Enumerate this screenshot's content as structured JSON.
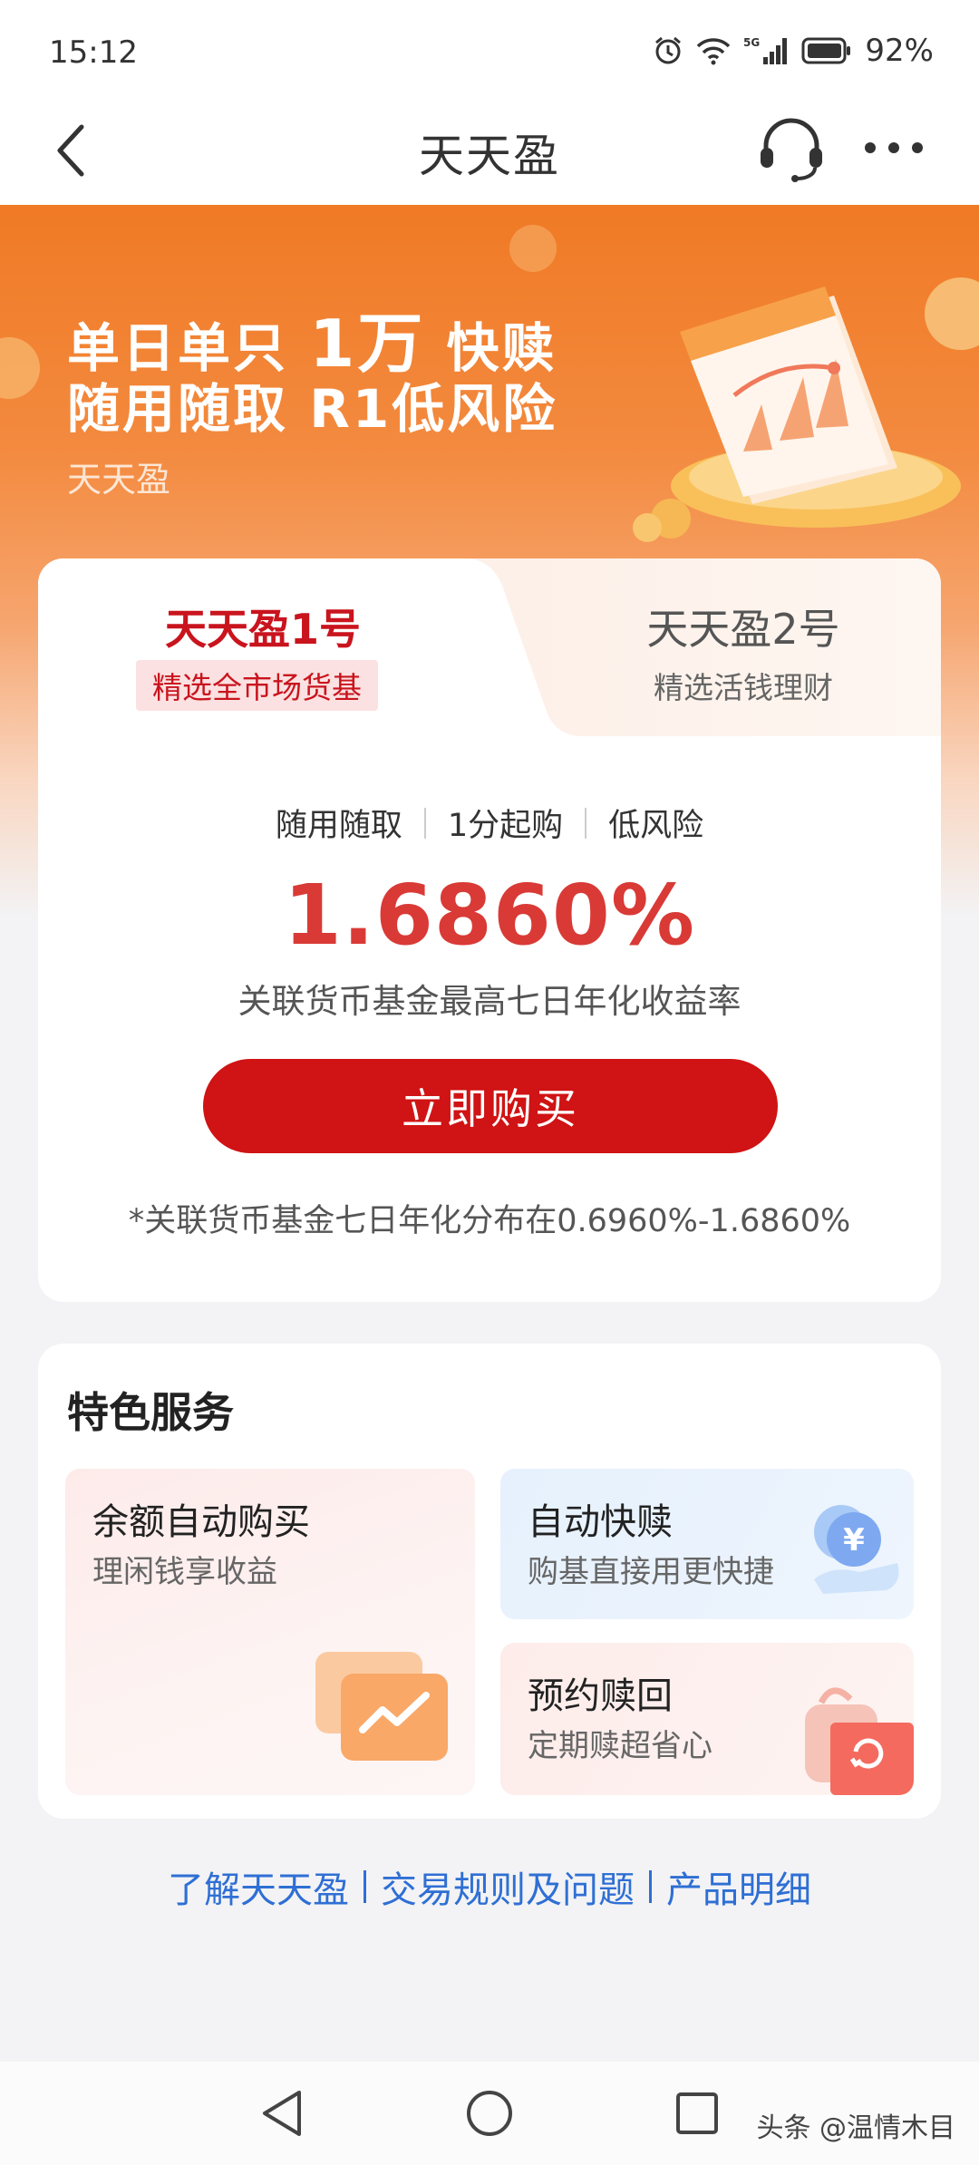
{
  "status_bar": {
    "time": "15:12",
    "battery": "92%",
    "network": "5G"
  },
  "nav": {
    "title": "天天盈",
    "back_icon": "chevron-left-icon",
    "service_icon": "headset-icon",
    "more_icon": "more-dots-icon"
  },
  "hero": {
    "line1_a": "单日单只",
    "line1_b": "1万",
    "line1_c": "快赎",
    "line2": "随用随取 R1低风险",
    "brand": "天天盈"
  },
  "product": {
    "tabs": [
      {
        "name": "天天盈1号",
        "subtitle": "精选全市场货基",
        "active": true
      },
      {
        "name": "天天盈2号",
        "subtitle": "精选活钱理财",
        "active": false
      }
    ],
    "features": [
      "随用随取",
      "1分起购",
      "低风险"
    ],
    "rate": "1.6860%",
    "rate_label": "关联货币基金最高七日年化收益率",
    "buy_label": "立即购买",
    "footnote": "*关联货币基金七日年化分布在0.6960%-1.6860%"
  },
  "services": {
    "title": "特色服务",
    "items": [
      {
        "title": "余额自动购买",
        "subtitle": "理闲钱享收益",
        "icon": "chart-screen-icon"
      },
      {
        "title": "自动快赎",
        "subtitle": "购基直接用更快捷",
        "icon": "yuan-coin-icon"
      },
      {
        "title": "预约赎回",
        "subtitle": "定期赎超省心",
        "icon": "refresh-bag-icon"
      }
    ]
  },
  "links": [
    "了解天天盈",
    "交易规则及问题",
    "产品明细"
  ],
  "system_nav": {
    "back": "triangle-back-icon",
    "home": "circle-home-icon",
    "recents": "square-recents-icon",
    "watermark": "头条 @温情木目"
  },
  "colors": {
    "brand_red": "#d01314",
    "rate_red": "#d93a36",
    "hero_orange": "#f07a25",
    "link_blue": "#2f6fd4"
  }
}
